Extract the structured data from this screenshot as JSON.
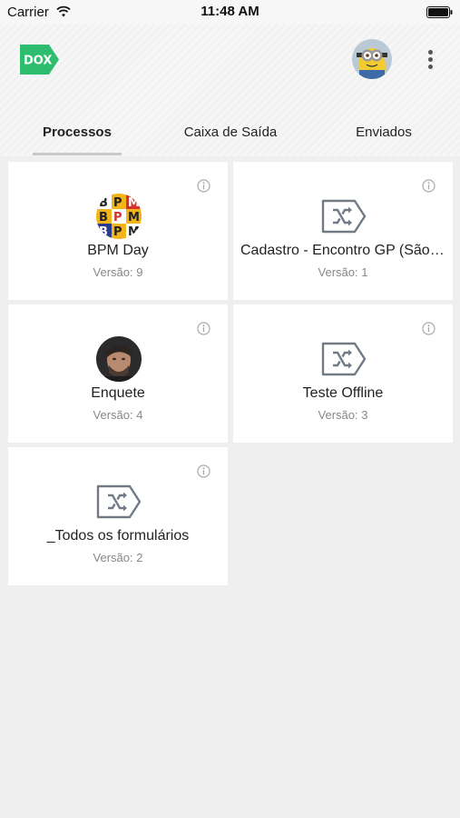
{
  "status_bar": {
    "carrier": "Carrier",
    "time": "11:48 AM"
  },
  "header": {
    "logo_text": "DOX",
    "brand_color": "#2ebd6e"
  },
  "tabs": [
    {
      "label": "Processos",
      "active": true
    },
    {
      "label": "Caixa de Saída",
      "active": false
    },
    {
      "label": "Enviados",
      "active": false
    }
  ],
  "cards": [
    {
      "title": "BPM Day",
      "version": "Versão: 9",
      "icon": "bpm-logo-icon"
    },
    {
      "title": "Cadastro - Encontro GP (São Paulo)",
      "version": "Versão: 1",
      "icon": "shuffle-tag-icon"
    },
    {
      "title": "Enquete",
      "version": "Versão: 4",
      "icon": "user-photo-icon"
    },
    {
      "title": "Teste Offline",
      "version": "Versão: 3",
      "icon": "shuffle-tag-icon"
    },
    {
      "title": "_Todos os formulários",
      "version": "Versão: 2",
      "icon": "shuffle-tag-icon"
    }
  ]
}
